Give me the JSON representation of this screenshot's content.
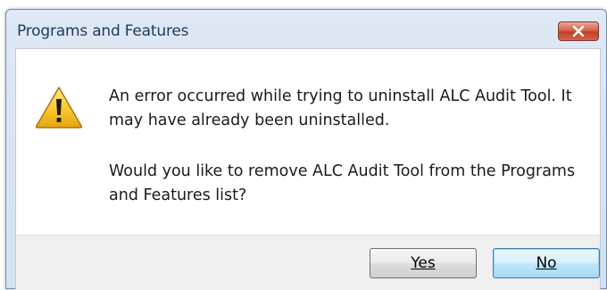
{
  "dialog": {
    "title": "Programs and Features",
    "close_icon": "close-icon",
    "warning_icon": "warning-icon",
    "message_line_1": "An error occurred while trying to uninstall ALC Audit Tool. It may have already been uninstalled.",
    "message_line_2": "Would you like to remove ALC Audit Tool from the Programs and Features list?",
    "buttons": {
      "yes": "Yes",
      "no": "No"
    },
    "colors": {
      "close_button": "#c94a32",
      "default_button_border": "#3c7fb1",
      "warning_fill": "#f7c42a"
    }
  }
}
